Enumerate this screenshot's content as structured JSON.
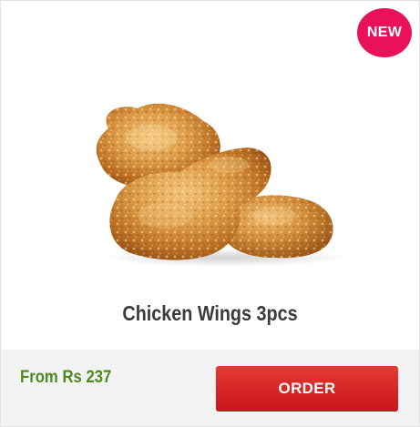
{
  "product": {
    "badge": "NEW",
    "image_icon": "chicken-wings-photo-icon",
    "name": "Chicken Wings 3pcs",
    "price_label": "From Rs 237",
    "order_label": "ORDER"
  },
  "colors": {
    "badge": "#e8115a",
    "price": "#4e8a21",
    "order_button": "#d9261f",
    "title": "#3b3b3b",
    "footer_bg": "#f2f2f2"
  }
}
